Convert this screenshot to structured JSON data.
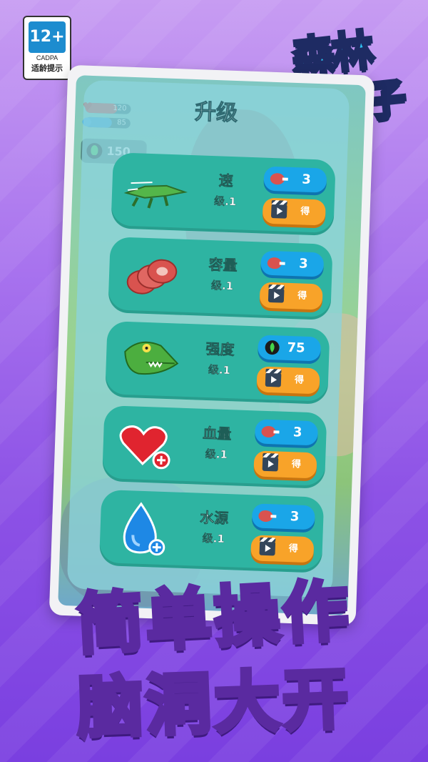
{
  "rating": {
    "age": "12+",
    "org": "CADPA",
    "tip": "适龄提示"
  },
  "logo": {
    "line1": "森林",
    "line2": "拉把子"
  },
  "hud": {
    "health": "120",
    "water": "85",
    "food": "150",
    "bg_title": "升 级 己"
  },
  "panel": {
    "title": "升级",
    "items": [
      {
        "name": "速",
        "level": "级.1",
        "cost": "3",
        "cost_icon": "meat-icon",
        "ad_label": "得"
      },
      {
        "name": "容量",
        "level": "级.1",
        "cost": "3",
        "cost_icon": "meat-icon",
        "ad_label": "得"
      },
      {
        "name": "强度",
        "level": "级.1",
        "cost": "75",
        "cost_icon": "plant-icon",
        "ad_label": "得"
      },
      {
        "name": "血量",
        "level": "级.1",
        "cost": "3",
        "cost_icon": "meat-icon",
        "ad_label": "得"
      },
      {
        "name": "水源",
        "level": "级.1",
        "cost": "3",
        "cost_icon": "meat-icon",
        "ad_label": "得"
      }
    ]
  },
  "slogan": {
    "line1": "简单操作",
    "line2": "脑洞大开"
  },
  "colors": {
    "card": "#2eb4a2",
    "cost_button": "#1aa6e8",
    "ad_button": "#f8a329",
    "background": "#a873ee"
  }
}
